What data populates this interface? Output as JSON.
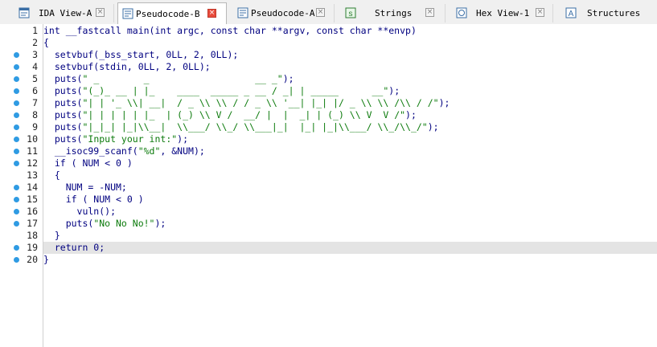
{
  "tabs": [
    {
      "label": "IDA View-A",
      "icon": "ida-view-icon",
      "active": false
    },
    {
      "label": "Pseudocode-B",
      "icon": "pseudocode-icon",
      "active": true
    },
    {
      "label": "Pseudocode-A",
      "icon": "pseudocode-icon",
      "active": false
    },
    {
      "label": "Strings",
      "icon": "strings-icon",
      "active": false
    },
    {
      "label": "Hex View-1",
      "icon": "hex-view-icon",
      "active": false
    },
    {
      "label": "Structures",
      "icon": "structures-icon",
      "active": false
    }
  ],
  "close_glyph": "×",
  "colors": {
    "code_text": "#000080",
    "string_literal": "#0b7a0b",
    "breakpoint_dot": "#2f9be3",
    "current_line_highlight": "#e4e4e4",
    "active_close": "#e84c3d"
  },
  "code": {
    "lines": [
      {
        "num": "1",
        "text": "int __fastcall main(int argc, const char **argv, const char **envp)",
        "dot": false
      },
      {
        "num": "2",
        "text": "{",
        "dot": false
      },
      {
        "num": "3",
        "text": "  setvbuf(_bss_start, 0LL, 2, 0LL);",
        "dot": true
      },
      {
        "num": "4",
        "text": "  setvbuf(stdin, 0LL, 2, 0LL);",
        "dot": true
      },
      {
        "num": "5",
        "text": "  puts(\" _        _                   __ _\");",
        "dot": true
      },
      {
        "num": "6",
        "text": "  puts(\"(_)_ __ | |_    ____  _____ _ __ / _| | _____      __\");",
        "dot": true
      },
      {
        "num": "7",
        "text": "  puts(\"| | '_ \\\\| __|  / _ \\\\ \\\\ / / _ \\\\ '__| |_| |/ _ \\\\ \\\\ /\\\\ / /\");",
        "dot": true
      },
      {
        "num": "8",
        "text": "  puts(\"| | | | | |_  | (_) \\\\ V /  __/ |  |  _| | (_) \\\\ V  V /\");",
        "dot": true
      },
      {
        "num": "9",
        "text": "  puts(\"|_|_| |_|\\\\__|  \\\\___/ \\\\_/ \\\\___|_|  |_| |_|\\\\___/ \\\\_/\\\\_/\");",
        "dot": true
      },
      {
        "num": "10",
        "text": "  puts(\"Input your int:\");",
        "dot": true
      },
      {
        "num": "11",
        "text": "  __isoc99_scanf(\"%d\", &NUM);",
        "dot": true
      },
      {
        "num": "12",
        "text": "  if ( NUM < 0 )",
        "dot": true
      },
      {
        "num": "13",
        "text": "  {",
        "dot": false
      },
      {
        "num": "14",
        "text": "    NUM = -NUM;",
        "dot": true
      },
      {
        "num": "15",
        "text": "    if ( NUM < 0 )",
        "dot": true
      },
      {
        "num": "16",
        "text": "      vuln();",
        "dot": true
      },
      {
        "num": "17",
        "text": "    puts(\"No No No!\");",
        "dot": true
      },
      {
        "num": "18",
        "text": "  }",
        "dot": false
      },
      {
        "num": "19",
        "text": "  return 0;",
        "dot": true
      },
      {
        "num": "20",
        "text": "}",
        "dot": true
      }
    ],
    "highlighted_line": "19"
  }
}
